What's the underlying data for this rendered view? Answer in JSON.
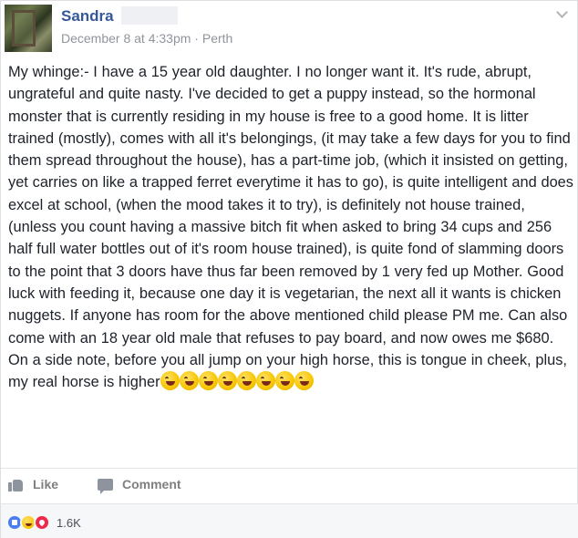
{
  "post": {
    "author": "Sandra",
    "date": "December 8 at 4:33pm",
    "separator": "·",
    "location": "Perth",
    "text": "My whinge:- I have a 15 year old daughter. I no longer want it. It's rude, abrupt, ungrateful and quite nasty. I've decided to get a puppy instead, so the hormonal monster that is currently residing in my house is free to a good home. It is litter trained (mostly), comes with all it's belongings, (it may take a few days for you to find them spread throughout the house), has a part-time job, (which it insisted on getting, yet carries on like a trapped ferret everytime it has to go), is quite intelligent and does excel at school, (when the mood takes it to try), is definitely not house trained, (unless you count having a massive bitch fit when asked to bring 34 cups and 256 half full water bottles out of it's room house trained), is quite fond of slamming doors to the point that 3 doors have thus far been removed by 1 very fed up Mother. Good luck with feeding it, because one day it is vegetarian, the next all it wants is chicken nuggets. If anyone has room for the above mentioned child please PM me. Can also come with an 18 year old male that refuses to pay board, and now owes me $680. On a side note, before you all jump on your high horse, this is tongue in cheek, plus, my real horse is higher",
    "emoji_count": 8,
    "emoji_icon": "laughing-tongue-emoji"
  },
  "actions": {
    "like_label": "Like",
    "comment_label": "Comment"
  },
  "reactions": {
    "types": [
      "like",
      "haha",
      "love"
    ],
    "count": "1.6K"
  },
  "colors": {
    "author_link": "#365899",
    "meta_gray": "#90949c",
    "reaction_like": "#4a7df0",
    "reaction_love": "#f0284a"
  }
}
